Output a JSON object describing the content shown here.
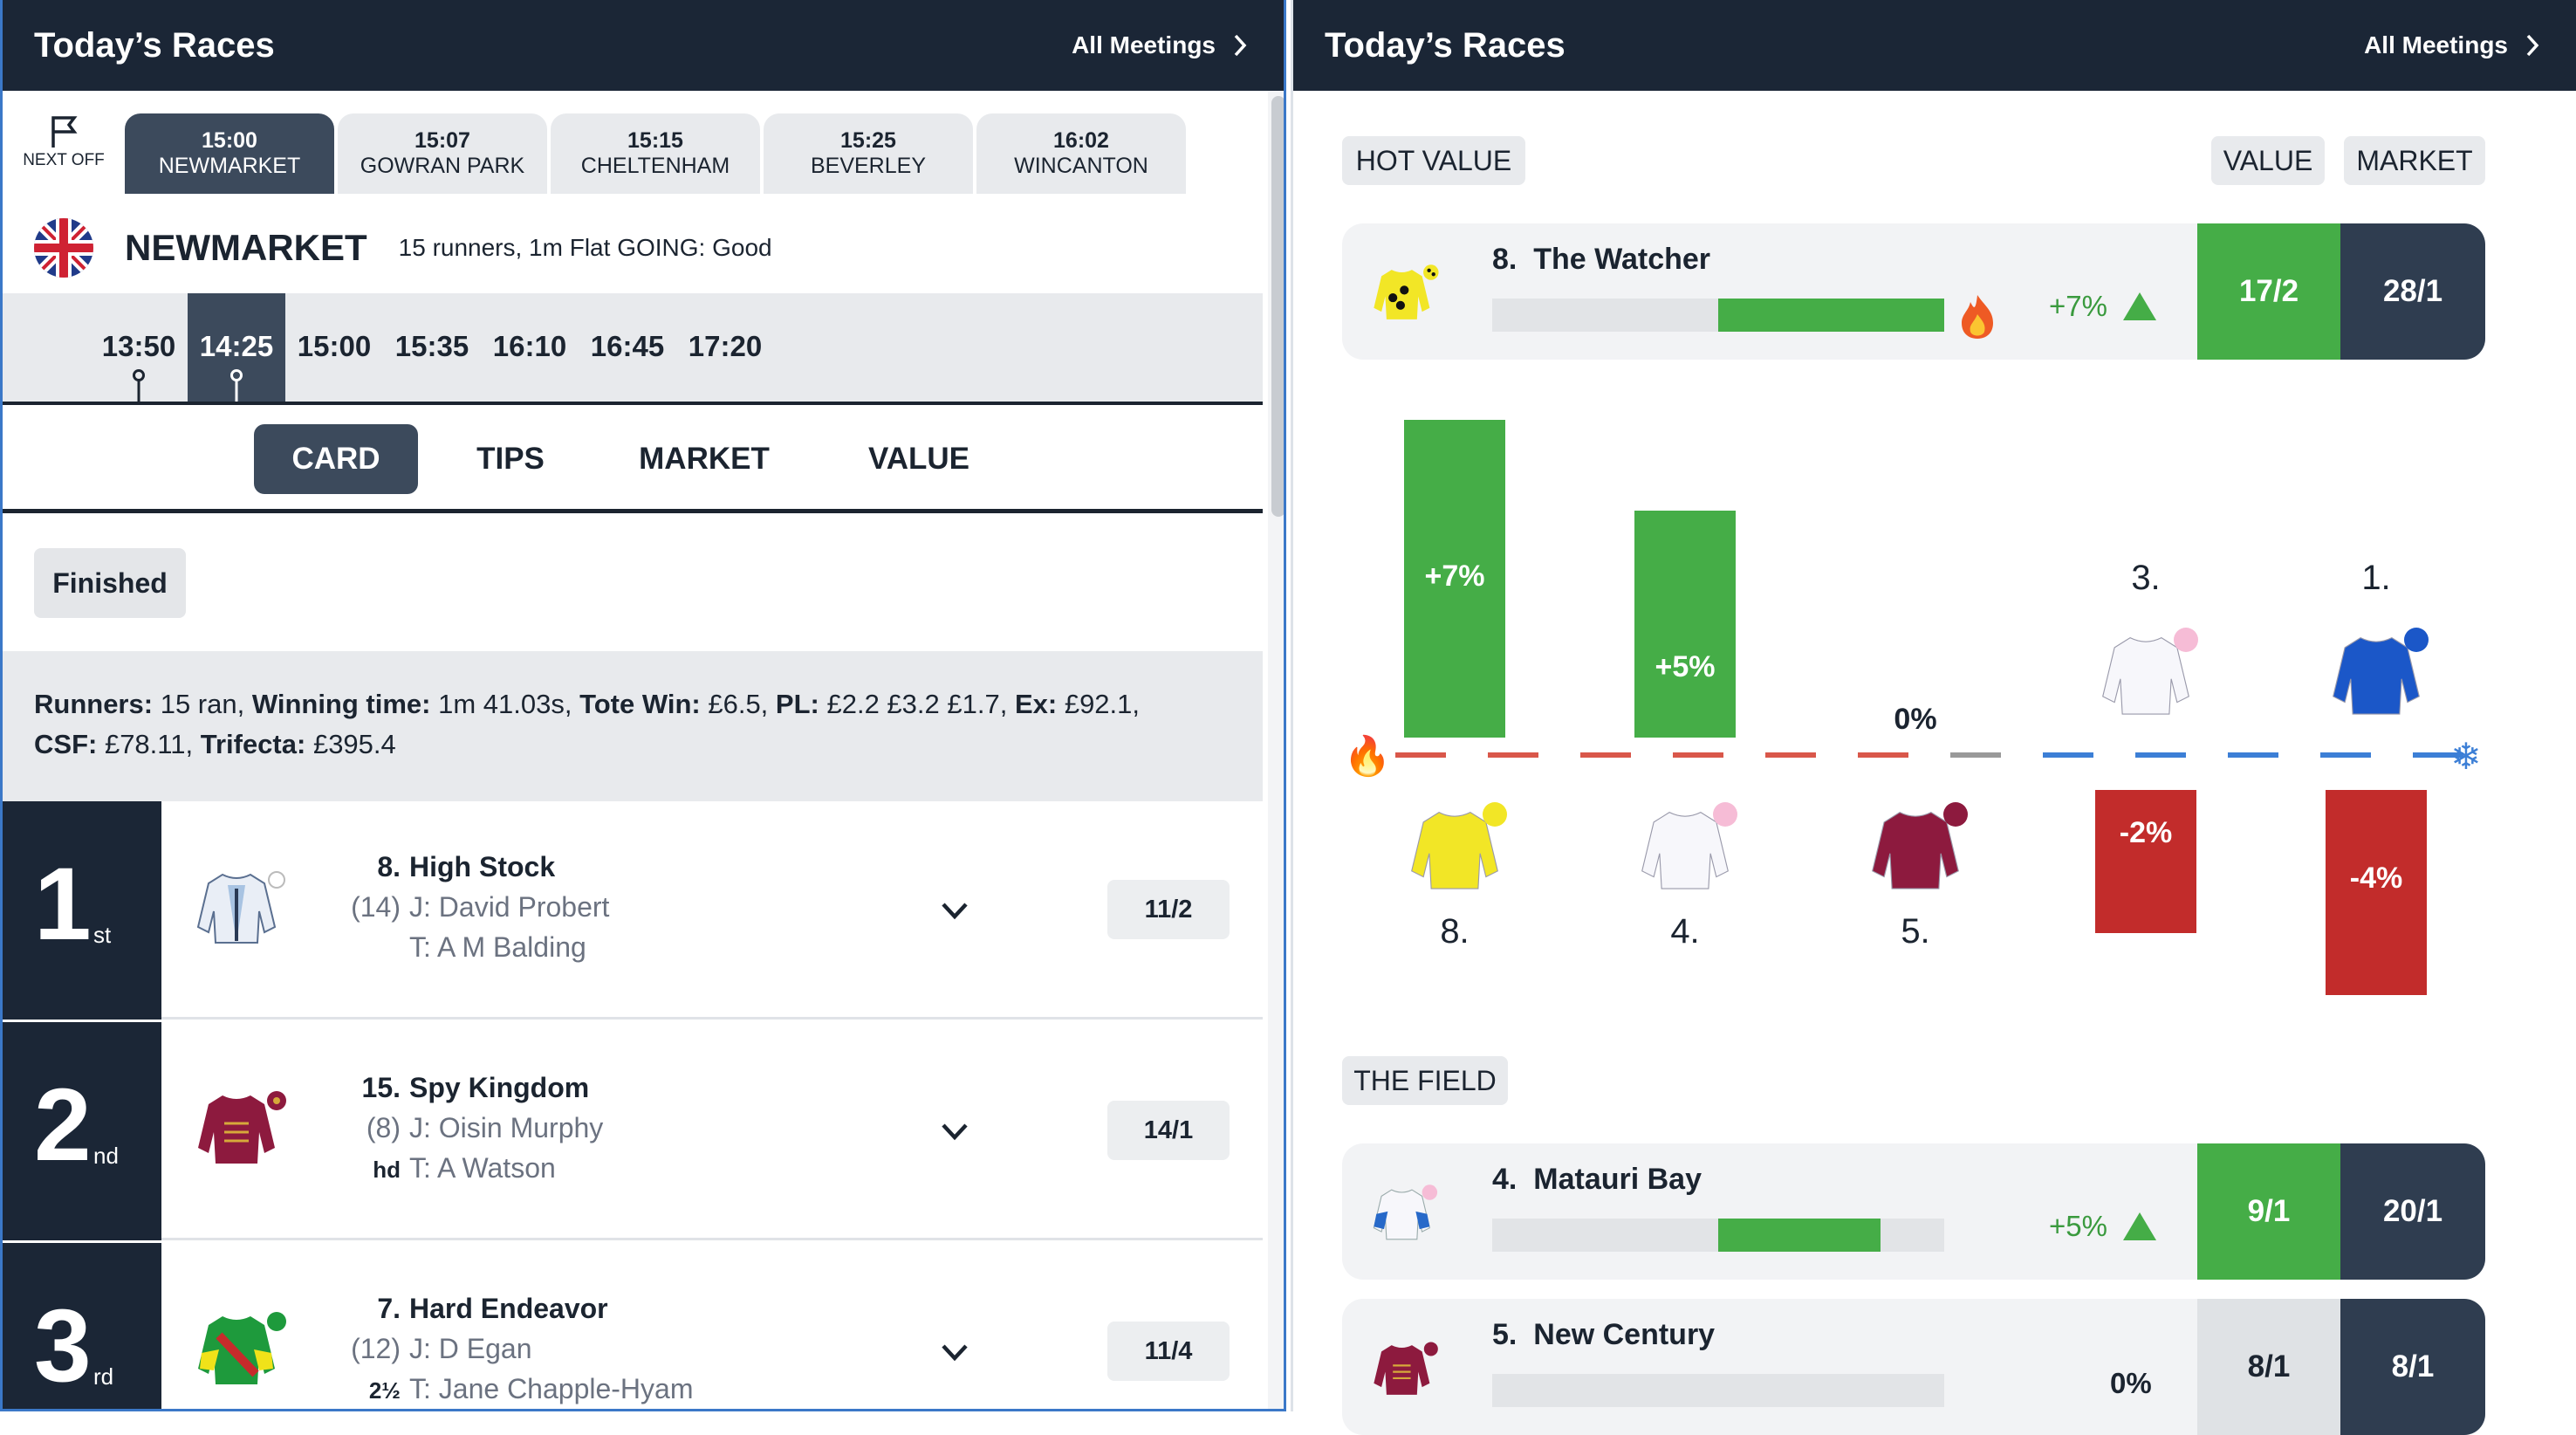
{
  "left": {
    "header": {
      "title": "Today’s Races",
      "meetings_link": "All Meetings"
    },
    "next_off_label": "NEXT OFF",
    "race_tabs": [
      {
        "time": "15:00",
        "venue": "NEWMARKET",
        "active": true
      },
      {
        "time": "15:07",
        "venue": "GOWRAN PARK",
        "active": false
      },
      {
        "time": "15:15",
        "venue": "CHELTENHAM",
        "active": false
      },
      {
        "time": "15:25",
        "venue": "BEVERLEY",
        "active": false
      },
      {
        "time": "16:02",
        "venue": "WINCANTON",
        "active": false
      }
    ],
    "venue": {
      "name": "NEWMARKET",
      "info": "15 runners, 1m Flat GOING: Good"
    },
    "race_times": [
      "13:50",
      "14:25",
      "15:00",
      "15:35",
      "16:10",
      "16:45",
      "17:20"
    ],
    "selected_time": "14:25",
    "sub_tabs": [
      "CARD",
      "TIPS",
      "MARKET",
      "VALUE"
    ],
    "active_sub_tab": "CARD",
    "status_badge": "Finished",
    "summary": {
      "runners_label": "Runners:",
      "runners": "15 ran,",
      "time_label": "Winning time:",
      "time": "1m 41.03s,",
      "tote_label": "Tote Win:",
      "tote": "£6.5,",
      "pl_label": "PL:",
      "pl": "£2.2 £3.2 £1.7,",
      "ex_label": "Ex:",
      "ex": "£92.1,",
      "csf_label": "CSF:",
      "csf": "£78.11,",
      "trifecta_label": "Trifecta:",
      "trifecta": "£395.4"
    },
    "results": [
      {
        "pos": "1",
        "ord": "st",
        "num": "8.",
        "name": "High Stock",
        "draw": "(14)",
        "jockey": "J: David Probert",
        "margin": "",
        "trainer": "T: A M Balding",
        "odds": "11/2",
        "silk": "white-blue"
      },
      {
        "pos": "2",
        "ord": "nd",
        "num": "15.",
        "name": "Spy Kingdom",
        "draw": "(8)",
        "jockey": "J: Oisin Murphy",
        "margin": "hd",
        "trainer": "T: A Watson",
        "odds": "14/1",
        "silk": "maroon"
      },
      {
        "pos": "3",
        "ord": "rd",
        "num": "7.",
        "name": "Hard Endeavor",
        "draw": "(12)",
        "jockey": "J: D Egan",
        "margin": "2½",
        "trainer": "T: Jane Chapple-Hyam",
        "odds": "11/4",
        "silk": "green-yellow"
      }
    ]
  },
  "right": {
    "header": {
      "title": "Today’s Races",
      "meetings_link": "All Meetings"
    },
    "hot_value_label": "HOT VALUE",
    "value_label": "VALUE",
    "market_label": "MARKET",
    "hot_value": {
      "num": "8.",
      "name": "The Watcher",
      "bar_fraction": 0.5,
      "pct": "+7%",
      "value": "17/2",
      "market": "28/1"
    },
    "chart_data": {
      "type": "bar",
      "categories": [
        "8.",
        "4.",
        "5.",
        "3.",
        "1."
      ],
      "values": [
        7,
        5,
        0,
        -2,
        -4
      ],
      "value_labels": [
        "+7%",
        "+5%",
        "0%",
        "-2%",
        "-4%"
      ],
      "colors": {
        "positive": "#45ad47",
        "negative": "#c22c2b"
      }
    },
    "field_label": "THE FIELD",
    "field": [
      {
        "num": "4.",
        "name": "Matauri Bay",
        "bar_fraction": 0.36,
        "pct": "+5%",
        "value": "9/1",
        "market": "20/1"
      },
      {
        "num": "5.",
        "name": "New Century",
        "bar_fraction": 0,
        "pct": "0%",
        "value": "8/1",
        "market": "8/1"
      }
    ]
  }
}
